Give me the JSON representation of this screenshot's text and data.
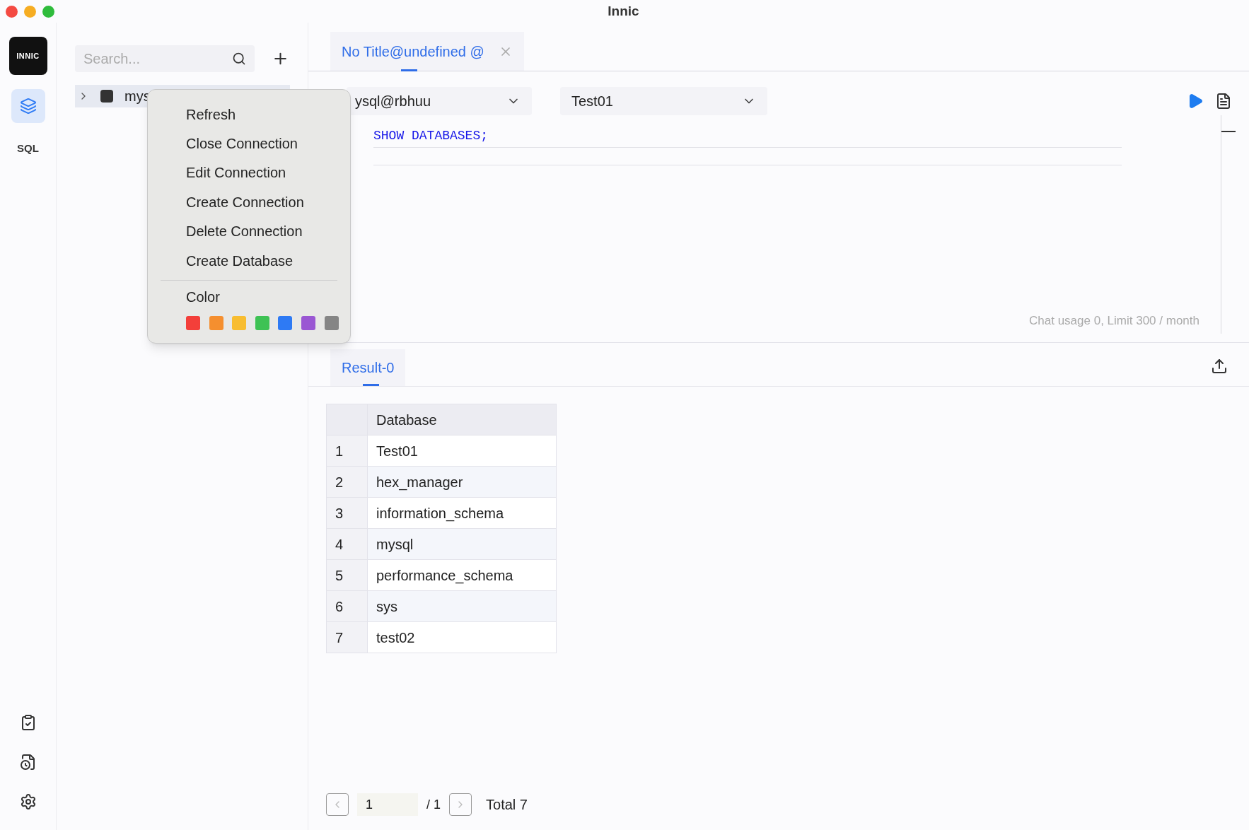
{
  "window": {
    "title": "Innic"
  },
  "rail": {
    "logo": "INNIC",
    "items": [
      {
        "kind": "database",
        "selected": true
      },
      {
        "kind": "sql",
        "label": "SQL",
        "selected": false
      }
    ],
    "bottom": [
      {
        "kind": "tasks"
      },
      {
        "kind": "history"
      },
      {
        "kind": "settings"
      }
    ]
  },
  "sidebar": {
    "search": {
      "placeholder": "Search..."
    },
    "tree": [
      {
        "label": "mys",
        "expanded": false,
        "selected": true
      }
    ]
  },
  "context_menu": {
    "items": [
      "Refresh",
      "Close Connection",
      "Edit Connection",
      "Create Connection",
      "Delete Connection",
      "Create Database"
    ],
    "color_label": "Color",
    "colors": [
      {
        "color": "#f33f3a"
      },
      {
        "color": "#f58f2f"
      },
      {
        "color": "#f8bd30"
      },
      {
        "color": "#3ec254"
      },
      {
        "color": "#2e7af4"
      },
      {
        "color": "#9a57d3"
      },
      {
        "color": "#858585"
      }
    ]
  },
  "editor_tabs": [
    {
      "label": "No Title@undefined @",
      "selected": true
    }
  ],
  "toolbar": {
    "connection": "ysql@rbhuu",
    "database": "Test01"
  },
  "editor": {
    "code": "SHOW DATABASES;",
    "usage": "Chat usage 0, Limit 300 / month"
  },
  "result_tabs": [
    {
      "label": "Result-0",
      "selected": true
    }
  ],
  "table": {
    "columns": [
      "Database"
    ],
    "rows": [
      {
        "index": "1",
        "value": "Test01"
      },
      {
        "index": "2",
        "value": "hex_manager"
      },
      {
        "index": "3",
        "value": "information_schema"
      },
      {
        "index": "4",
        "value": "mysql"
      },
      {
        "index": "5",
        "value": "performance_schema"
      },
      {
        "index": "6",
        "value": "sys"
      },
      {
        "index": "7",
        "value": "test02"
      }
    ]
  },
  "pagination": {
    "page": "1",
    "of": "/ 1",
    "total": "Total 7"
  }
}
